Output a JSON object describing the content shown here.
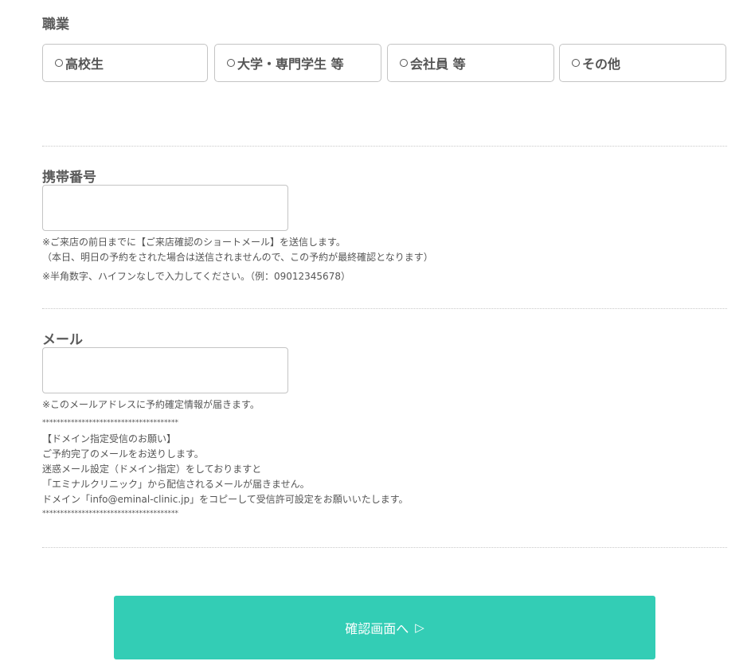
{
  "occupation": {
    "label": "職業",
    "options": [
      {
        "label": "高校生"
      },
      {
        "label": "大学・専門学生 等"
      },
      {
        "label": "会社員 等"
      },
      {
        "label": "その他"
      }
    ]
  },
  "phone": {
    "label": "携帯番号",
    "value": "",
    "placeholder": "",
    "notes": [
      "※ご来店の前日までに【ご来店確認のショートメール】を送信します。",
      "（本日、明日の予約をされた場合は送信されませんので、この予約が最終確認となります）",
      "※半角数字、ハイフンなしで入力してください。（例：09012345678）"
    ]
  },
  "email": {
    "label": "メール",
    "value": "",
    "placeholder": "",
    "notes": [
      "※このメールアドレスに予約確定情報が届きます。",
      "**************************************",
      "【ドメイン指定受信のお願い】",
      "ご予約完了のメールをお送りします。",
      "迷惑メール設定（ドメイン指定）をしておりますと",
      "「エミナルクリニック」から配信されるメールが届きません。",
      "ドメイン「info@eminal-clinic.jp」をコピーして受信許可設定をお願いいたします。",
      "**************************************"
    ]
  },
  "submit": {
    "label": "確認画面へ",
    "icon": "play-outline-icon"
  },
  "colors": {
    "accent": "#33cdb5",
    "border": "#c4c4c4",
    "text": "#555555"
  }
}
